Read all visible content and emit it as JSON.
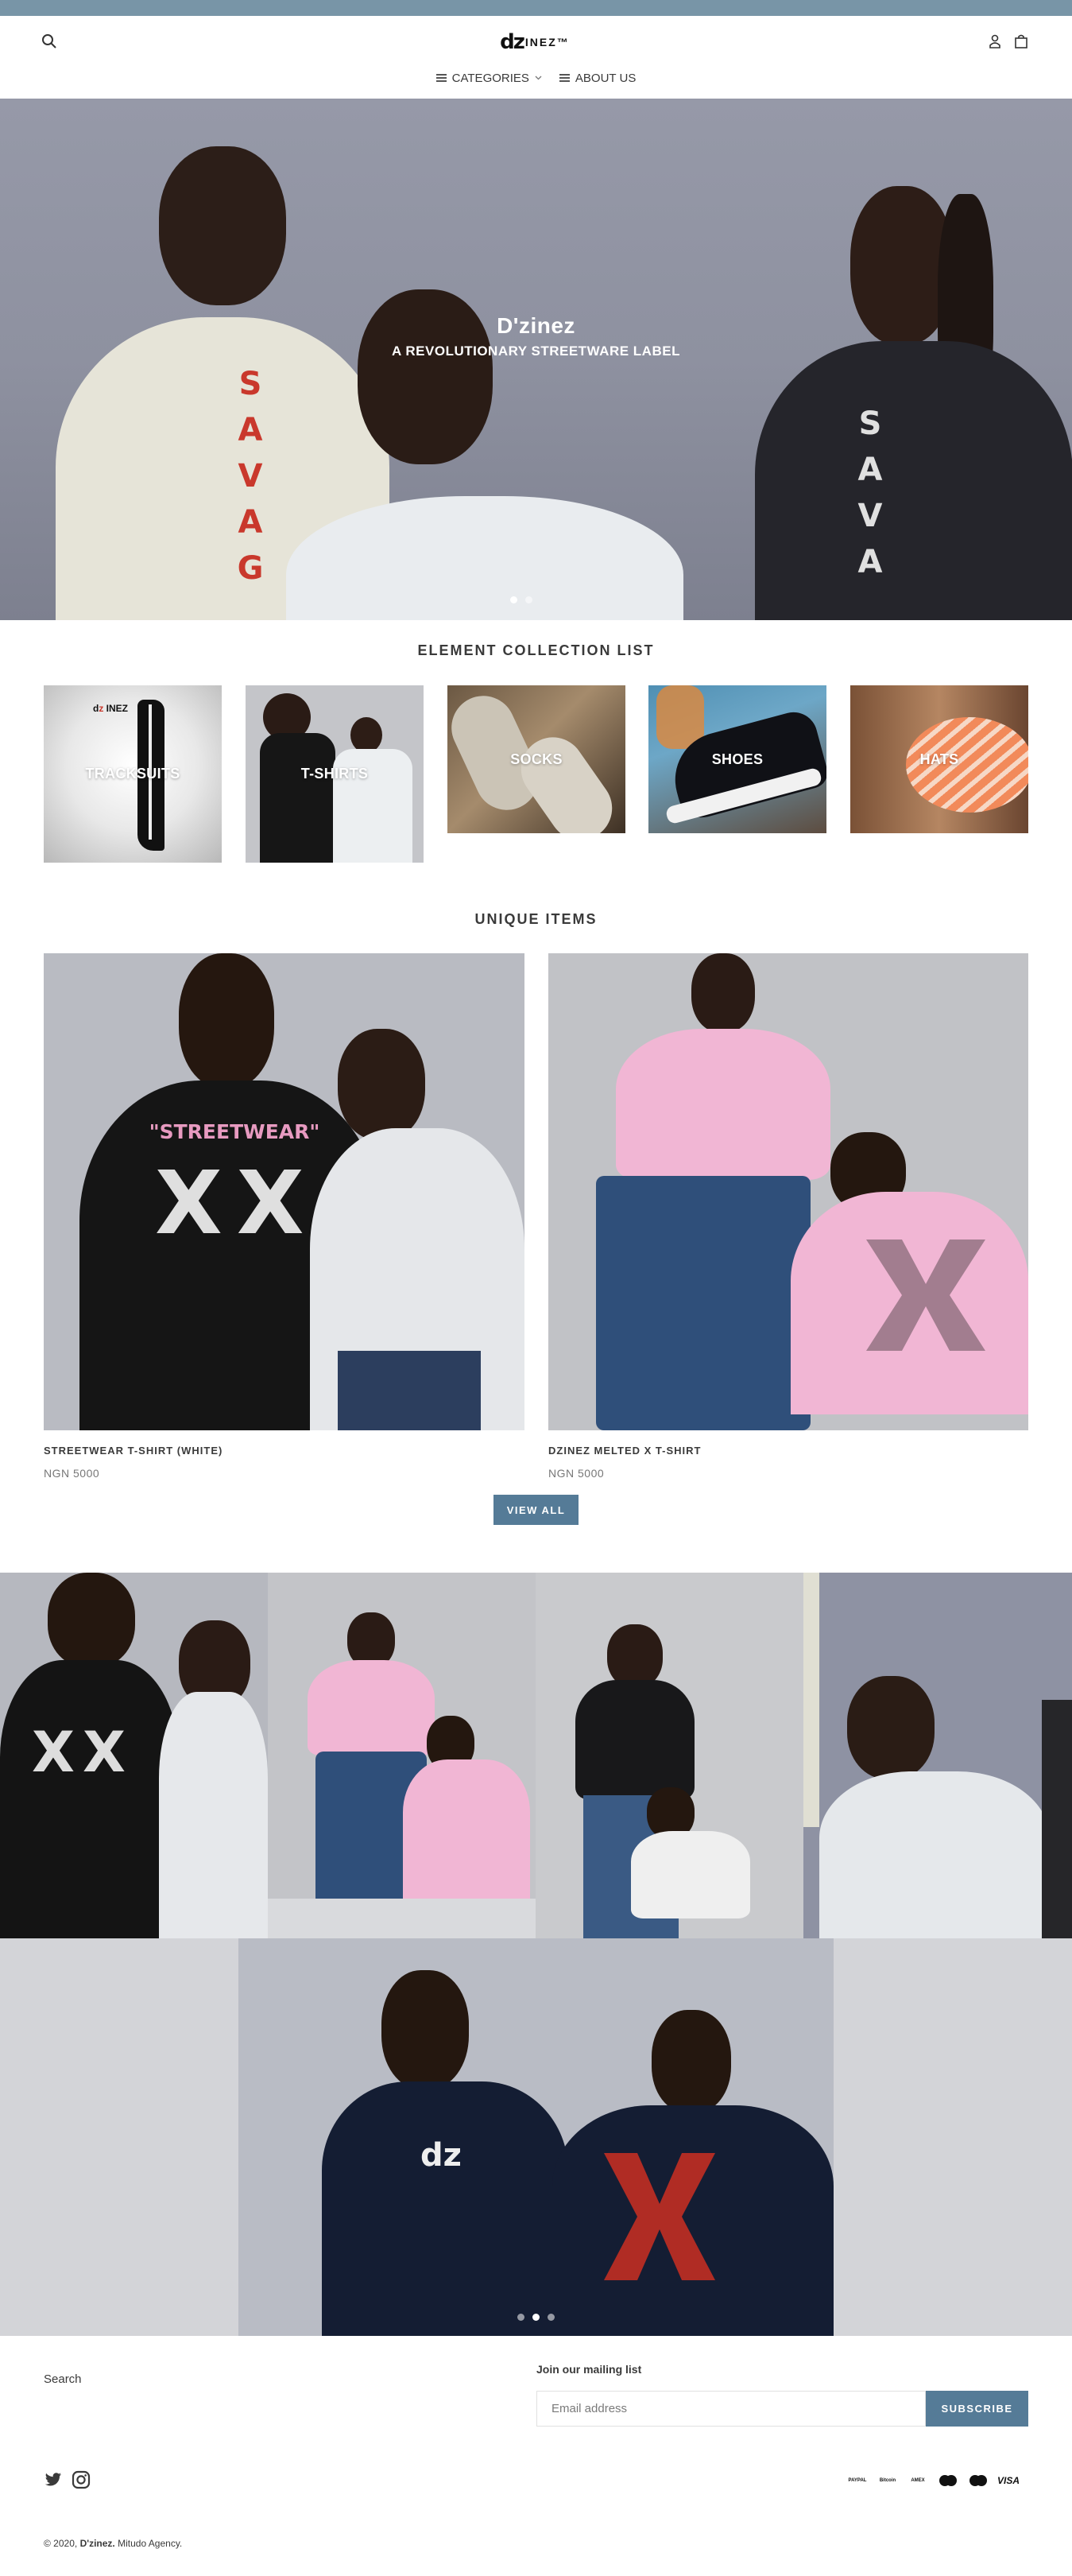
{
  "colors": {
    "accent": "#557b97",
    "topbar": "#7895a7",
    "text": "#3a3a3a"
  },
  "header": {
    "logo_mark": "dz",
    "logo_text": "INEZ™",
    "nav": [
      {
        "label": "CATEGORIES",
        "icon": "menu-icon",
        "has_dropdown": true
      },
      {
        "label": "ABOUT US",
        "icon": "menu-icon",
        "has_dropdown": false
      }
    ]
  },
  "hero": {
    "title": "D'zinez",
    "subtitle": "A REVOLUTIONARY STREETWARE LABEL",
    "shirt_left": "S A V A G",
    "shirt_right": "S A V A",
    "slide_index": 1,
    "slide_count": 2
  },
  "collections": {
    "title": "ELEMENT COLLECTION LIST",
    "items": [
      {
        "label": "TRACKSUITS"
      },
      {
        "label": "T-SHIRTS"
      },
      {
        "label": "SOCKS"
      },
      {
        "label": "SHOES"
      },
      {
        "label": "HATS"
      }
    ]
  },
  "featured": {
    "title": "UNIQUE ITEMS",
    "products": [
      {
        "name": "STREETWEAR T-SHIRT (WHITE)",
        "price": "NGN 5000",
        "shirt_print": "\"STREETWEAR\""
      },
      {
        "name": "DZINEZ MELTED X T-SHIRT",
        "price": "NGN 5000"
      }
    ],
    "view_all": "VIEW ALL"
  },
  "gallery": {
    "slide_count": 3,
    "active_slide": 2,
    "wide_shirt_mark": "dz"
  },
  "footer": {
    "search_link": "Search",
    "mailing_title": "Join our mailing list",
    "email_placeholder": "Email address",
    "subscribe": "SUBSCRIBE",
    "social": [
      "twitter-icon",
      "instagram-icon"
    ],
    "payments": [
      {
        "name": "PAYPAL",
        "icon": "paypal-icon"
      },
      {
        "name": "Bitcoin",
        "icon": "bitcoin-icon"
      },
      {
        "name": "AMEX",
        "icon": "amex-icon"
      },
      {
        "name": "MC",
        "icon": "mastercard-icon"
      },
      {
        "name": "MC",
        "icon": "maestro-icon"
      },
      {
        "name": "VISA",
        "icon": "visa-icon"
      }
    ],
    "copyright_prefix": "© 2020,",
    "brand": "D'zinez.",
    "agency": "Mitudo Agency."
  }
}
